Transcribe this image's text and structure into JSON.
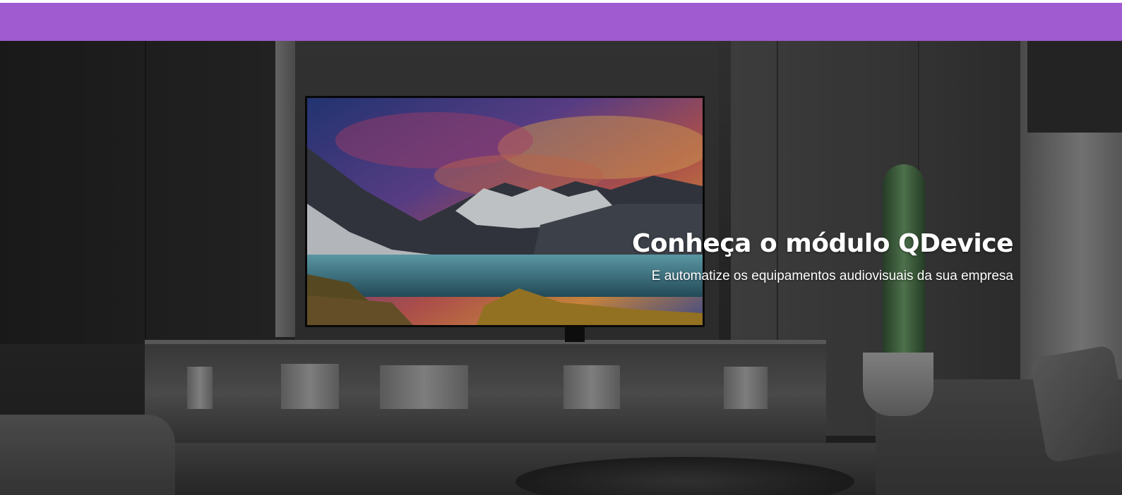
{
  "topbar": {
    "color": "#a05bd0"
  },
  "hero": {
    "title": "Conheça o módulo QDevice",
    "subtitle": "E automatize os equipamentos audiovisuais da sua empresa",
    "background_image": "living-room-tv-image"
  }
}
